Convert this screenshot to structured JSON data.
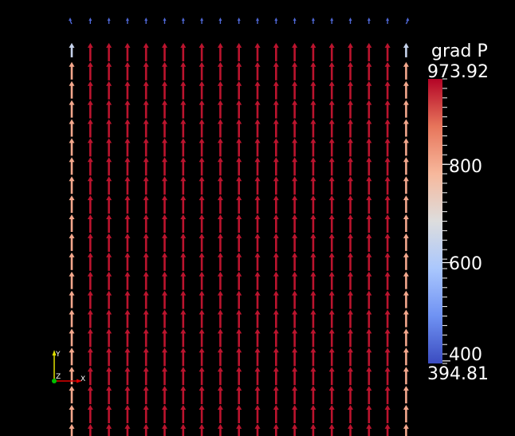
{
  "colorbar": {
    "title": "grad P",
    "range": [
      394.81,
      973.92
    ],
    "max_label": "973.92",
    "min_label": "394.81",
    "ticks": [
      {
        "value": 800,
        "label": "800"
      },
      {
        "value": 600,
        "label": "600"
      },
      {
        "value": 400,
        "label": "400"
      }
    ],
    "colormap": [
      "#3b4cc0",
      "#6f92f3",
      "#aac7fd",
      "#dddddd",
      "#f7b89c",
      "#e7755b",
      "#b40426"
    ]
  },
  "axes_triad": {
    "labels": {
      "y": "Y",
      "z": "Z",
      "x": "X"
    },
    "colors": {
      "y": "#e0e000",
      "z": "#00c000",
      "x": "#e00000"
    }
  },
  "glyph_field": {
    "columns": 19,
    "rows": 22,
    "top_row_value": 430,
    "edge_column_value": 805,
    "second_row_edge_value": 640,
    "interior_value": 960
  }
}
